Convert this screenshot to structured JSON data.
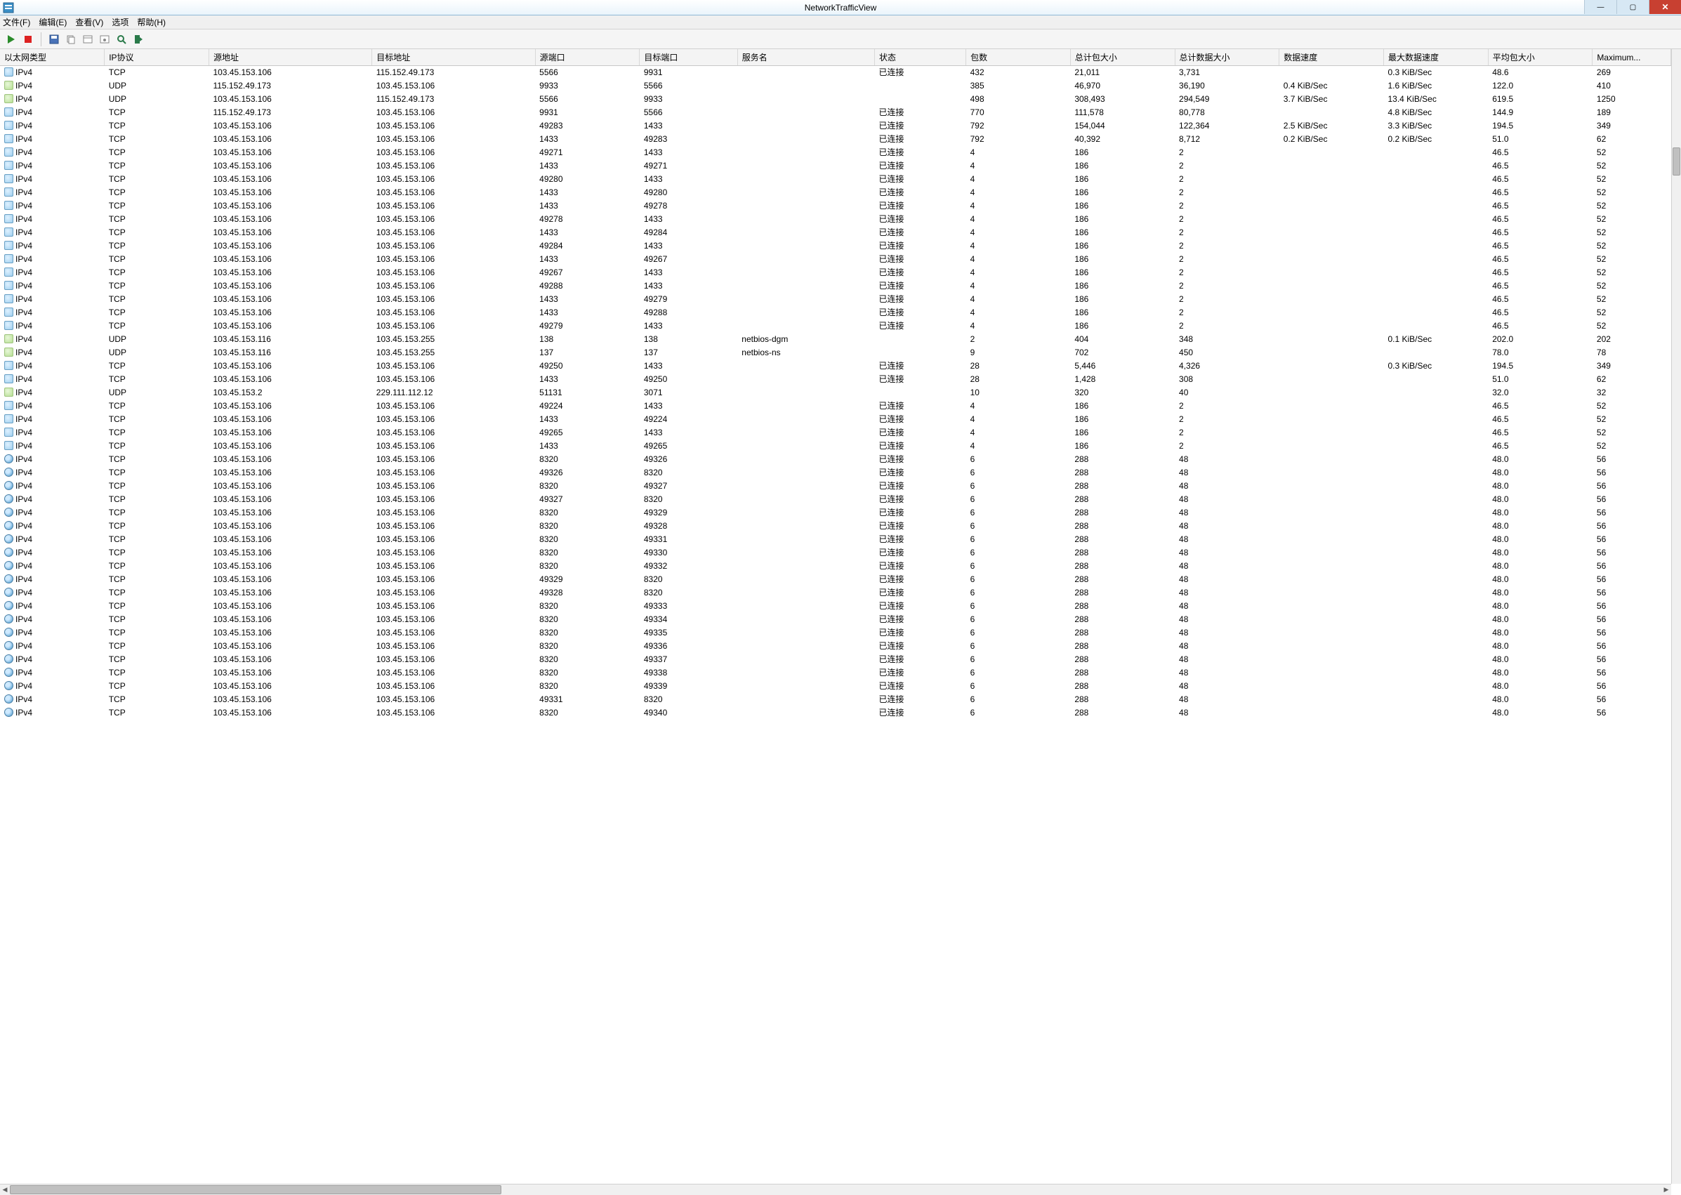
{
  "window": {
    "title": "NetworkTrafficView",
    "buttons": {
      "min": "—",
      "max": "▢",
      "close": "✕"
    }
  },
  "menu": {
    "items": [
      "文件(F)",
      "编辑(E)",
      "查看(V)",
      "选项",
      "帮助(H)"
    ]
  },
  "columns": [
    {
      "key": "eth",
      "label": "以太网类型",
      "w": 80
    },
    {
      "key": "proto",
      "label": "IP协议",
      "w": 80
    },
    {
      "key": "src",
      "label": "源地址",
      "w": 125
    },
    {
      "key": "dst",
      "label": "目标地址",
      "w": 125
    },
    {
      "key": "sport",
      "label": "源端口",
      "w": 80
    },
    {
      "key": "dport",
      "label": "目标端口",
      "w": 75
    },
    {
      "key": "svc",
      "label": "服务名",
      "w": 105
    },
    {
      "key": "status",
      "label": "状态",
      "w": 70
    },
    {
      "key": "pkts",
      "label": "包数",
      "w": 80
    },
    {
      "key": "tpsz",
      "label": "总计包大小",
      "w": 80
    },
    {
      "key": "tdsz",
      "label": "总计数据大小",
      "w": 80
    },
    {
      "key": "rate",
      "label": "数据速度",
      "w": 80
    },
    {
      "key": "maxrate",
      "label": "最大数据速度",
      "w": 80
    },
    {
      "key": "avgsz",
      "label": "平均包大小",
      "w": 80
    },
    {
      "key": "max",
      "label": "Maximum...",
      "w": 60
    }
  ],
  "rows": [
    {
      "ico": "a",
      "eth": "IPv4",
      "proto": "TCP",
      "src": "103.45.153.106",
      "dst": "115.152.49.173",
      "sport": "5566",
      "dport": "9931",
      "svc": "",
      "status": "已连接",
      "pkts": "432",
      "tpsz": "21,011",
      "tdsz": "3,731",
      "rate": "",
      "maxrate": "0.3 KiB/Sec",
      "avgsz": "48.6",
      "max": "269"
    },
    {
      "ico": "b",
      "eth": "IPv4",
      "proto": "UDP",
      "src": "115.152.49.173",
      "dst": "103.45.153.106",
      "sport": "9933",
      "dport": "5566",
      "svc": "",
      "status": "",
      "pkts": "385",
      "tpsz": "46,970",
      "tdsz": "36,190",
      "rate": "0.4 KiB/Sec",
      "maxrate": "1.6 KiB/Sec",
      "avgsz": "122.0",
      "max": "410"
    },
    {
      "ico": "b",
      "eth": "IPv4",
      "proto": "UDP",
      "src": "103.45.153.106",
      "dst": "115.152.49.173",
      "sport": "5566",
      "dport": "9933",
      "svc": "",
      "status": "",
      "pkts": "498",
      "tpsz": "308,493",
      "tdsz": "294,549",
      "rate": "3.7 KiB/Sec",
      "maxrate": "13.4 KiB/Sec",
      "avgsz": "619.5",
      "max": "1250"
    },
    {
      "ico": "a",
      "eth": "IPv4",
      "proto": "TCP",
      "src": "115.152.49.173",
      "dst": "103.45.153.106",
      "sport": "9931",
      "dport": "5566",
      "svc": "",
      "status": "已连接",
      "pkts": "770",
      "tpsz": "111,578",
      "tdsz": "80,778",
      "rate": "",
      "maxrate": "4.8 KiB/Sec",
      "avgsz": "144.9",
      "max": "189"
    },
    {
      "ico": "a",
      "eth": "IPv4",
      "proto": "TCP",
      "src": "103.45.153.106",
      "dst": "103.45.153.106",
      "sport": "49283",
      "dport": "1433",
      "svc": "",
      "status": "已连接",
      "pkts": "792",
      "tpsz": "154,044",
      "tdsz": "122,364",
      "rate": "2.5 KiB/Sec",
      "maxrate": "3.3 KiB/Sec",
      "avgsz": "194.5",
      "max": "349"
    },
    {
      "ico": "a",
      "eth": "IPv4",
      "proto": "TCP",
      "src": "103.45.153.106",
      "dst": "103.45.153.106",
      "sport": "1433",
      "dport": "49283",
      "svc": "",
      "status": "已连接",
      "pkts": "792",
      "tpsz": "40,392",
      "tdsz": "8,712",
      "rate": "0.2 KiB/Sec",
      "maxrate": "0.2 KiB/Sec",
      "avgsz": "51.0",
      "max": "62"
    },
    {
      "ico": "a",
      "eth": "IPv4",
      "proto": "TCP",
      "src": "103.45.153.106",
      "dst": "103.45.153.106",
      "sport": "49271",
      "dport": "1433",
      "svc": "",
      "status": "已连接",
      "pkts": "4",
      "tpsz": "186",
      "tdsz": "2",
      "rate": "",
      "maxrate": "",
      "avgsz": "46.5",
      "max": "52"
    },
    {
      "ico": "a",
      "eth": "IPv4",
      "proto": "TCP",
      "src": "103.45.153.106",
      "dst": "103.45.153.106",
      "sport": "1433",
      "dport": "49271",
      "svc": "",
      "status": "已连接",
      "pkts": "4",
      "tpsz": "186",
      "tdsz": "2",
      "rate": "",
      "maxrate": "",
      "avgsz": "46.5",
      "max": "52"
    },
    {
      "ico": "a",
      "eth": "IPv4",
      "proto": "TCP",
      "src": "103.45.153.106",
      "dst": "103.45.153.106",
      "sport": "49280",
      "dport": "1433",
      "svc": "",
      "status": "已连接",
      "pkts": "4",
      "tpsz": "186",
      "tdsz": "2",
      "rate": "",
      "maxrate": "",
      "avgsz": "46.5",
      "max": "52"
    },
    {
      "ico": "a",
      "eth": "IPv4",
      "proto": "TCP",
      "src": "103.45.153.106",
      "dst": "103.45.153.106",
      "sport": "1433",
      "dport": "49280",
      "svc": "",
      "status": "已连接",
      "pkts": "4",
      "tpsz": "186",
      "tdsz": "2",
      "rate": "",
      "maxrate": "",
      "avgsz": "46.5",
      "max": "52"
    },
    {
      "ico": "a",
      "eth": "IPv4",
      "proto": "TCP",
      "src": "103.45.153.106",
      "dst": "103.45.153.106",
      "sport": "1433",
      "dport": "49278",
      "svc": "",
      "status": "已连接",
      "pkts": "4",
      "tpsz": "186",
      "tdsz": "2",
      "rate": "",
      "maxrate": "",
      "avgsz": "46.5",
      "max": "52"
    },
    {
      "ico": "a",
      "eth": "IPv4",
      "proto": "TCP",
      "src": "103.45.153.106",
      "dst": "103.45.153.106",
      "sport": "49278",
      "dport": "1433",
      "svc": "",
      "status": "已连接",
      "pkts": "4",
      "tpsz": "186",
      "tdsz": "2",
      "rate": "",
      "maxrate": "",
      "avgsz": "46.5",
      "max": "52"
    },
    {
      "ico": "a",
      "eth": "IPv4",
      "proto": "TCP",
      "src": "103.45.153.106",
      "dst": "103.45.153.106",
      "sport": "1433",
      "dport": "49284",
      "svc": "",
      "status": "已连接",
      "pkts": "4",
      "tpsz": "186",
      "tdsz": "2",
      "rate": "",
      "maxrate": "",
      "avgsz": "46.5",
      "max": "52"
    },
    {
      "ico": "a",
      "eth": "IPv4",
      "proto": "TCP",
      "src": "103.45.153.106",
      "dst": "103.45.153.106",
      "sport": "49284",
      "dport": "1433",
      "svc": "",
      "status": "已连接",
      "pkts": "4",
      "tpsz": "186",
      "tdsz": "2",
      "rate": "",
      "maxrate": "",
      "avgsz": "46.5",
      "max": "52"
    },
    {
      "ico": "a",
      "eth": "IPv4",
      "proto": "TCP",
      "src": "103.45.153.106",
      "dst": "103.45.153.106",
      "sport": "1433",
      "dport": "49267",
      "svc": "",
      "status": "已连接",
      "pkts": "4",
      "tpsz": "186",
      "tdsz": "2",
      "rate": "",
      "maxrate": "",
      "avgsz": "46.5",
      "max": "52"
    },
    {
      "ico": "a",
      "eth": "IPv4",
      "proto": "TCP",
      "src": "103.45.153.106",
      "dst": "103.45.153.106",
      "sport": "49267",
      "dport": "1433",
      "svc": "",
      "status": "已连接",
      "pkts": "4",
      "tpsz": "186",
      "tdsz": "2",
      "rate": "",
      "maxrate": "",
      "avgsz": "46.5",
      "max": "52"
    },
    {
      "ico": "a",
      "eth": "IPv4",
      "proto": "TCP",
      "src": "103.45.153.106",
      "dst": "103.45.153.106",
      "sport": "49288",
      "dport": "1433",
      "svc": "",
      "status": "已连接",
      "pkts": "4",
      "tpsz": "186",
      "tdsz": "2",
      "rate": "",
      "maxrate": "",
      "avgsz": "46.5",
      "max": "52"
    },
    {
      "ico": "a",
      "eth": "IPv4",
      "proto": "TCP",
      "src": "103.45.153.106",
      "dst": "103.45.153.106",
      "sport": "1433",
      "dport": "49279",
      "svc": "",
      "status": "已连接",
      "pkts": "4",
      "tpsz": "186",
      "tdsz": "2",
      "rate": "",
      "maxrate": "",
      "avgsz": "46.5",
      "max": "52"
    },
    {
      "ico": "a",
      "eth": "IPv4",
      "proto": "TCP",
      "src": "103.45.153.106",
      "dst": "103.45.153.106",
      "sport": "1433",
      "dport": "49288",
      "svc": "",
      "status": "已连接",
      "pkts": "4",
      "tpsz": "186",
      "tdsz": "2",
      "rate": "",
      "maxrate": "",
      "avgsz": "46.5",
      "max": "52"
    },
    {
      "ico": "a",
      "eth": "IPv4",
      "proto": "TCP",
      "src": "103.45.153.106",
      "dst": "103.45.153.106",
      "sport": "49279",
      "dport": "1433",
      "svc": "",
      "status": "已连接",
      "pkts": "4",
      "tpsz": "186",
      "tdsz": "2",
      "rate": "",
      "maxrate": "",
      "avgsz": "46.5",
      "max": "52"
    },
    {
      "ico": "b",
      "eth": "IPv4",
      "proto": "UDP",
      "src": "103.45.153.116",
      "dst": "103.45.153.255",
      "sport": "138",
      "dport": "138",
      "svc": "netbios-dgm",
      "status": "",
      "pkts": "2",
      "tpsz": "404",
      "tdsz": "348",
      "rate": "",
      "maxrate": "0.1 KiB/Sec",
      "avgsz": "202.0",
      "max": "202"
    },
    {
      "ico": "b",
      "eth": "IPv4",
      "proto": "UDP",
      "src": "103.45.153.116",
      "dst": "103.45.153.255",
      "sport": "137",
      "dport": "137",
      "svc": "netbios-ns",
      "status": "",
      "pkts": "9",
      "tpsz": "702",
      "tdsz": "450",
      "rate": "",
      "maxrate": "",
      "avgsz": "78.0",
      "max": "78"
    },
    {
      "ico": "a",
      "eth": "IPv4",
      "proto": "TCP",
      "src": "103.45.153.106",
      "dst": "103.45.153.106",
      "sport": "49250",
      "dport": "1433",
      "svc": "",
      "status": "已连接",
      "pkts": "28",
      "tpsz": "5,446",
      "tdsz": "4,326",
      "rate": "",
      "maxrate": "0.3 KiB/Sec",
      "avgsz": "194.5",
      "max": "349"
    },
    {
      "ico": "a",
      "eth": "IPv4",
      "proto": "TCP",
      "src": "103.45.153.106",
      "dst": "103.45.153.106",
      "sport": "1433",
      "dport": "49250",
      "svc": "",
      "status": "已连接",
      "pkts": "28",
      "tpsz": "1,428",
      "tdsz": "308",
      "rate": "",
      "maxrate": "",
      "avgsz": "51.0",
      "max": "62"
    },
    {
      "ico": "b",
      "eth": "IPv4",
      "proto": "UDP",
      "src": "103.45.153.2",
      "dst": "229.111.112.12",
      "sport": "51131",
      "dport": "3071",
      "svc": "",
      "status": "",
      "pkts": "10",
      "tpsz": "320",
      "tdsz": "40",
      "rate": "",
      "maxrate": "",
      "avgsz": "32.0",
      "max": "32"
    },
    {
      "ico": "a",
      "eth": "IPv4",
      "proto": "TCP",
      "src": "103.45.153.106",
      "dst": "103.45.153.106",
      "sport": "49224",
      "dport": "1433",
      "svc": "",
      "status": "已连接",
      "pkts": "4",
      "tpsz": "186",
      "tdsz": "2",
      "rate": "",
      "maxrate": "",
      "avgsz": "46.5",
      "max": "52"
    },
    {
      "ico": "a",
      "eth": "IPv4",
      "proto": "TCP",
      "src": "103.45.153.106",
      "dst": "103.45.153.106",
      "sport": "1433",
      "dport": "49224",
      "svc": "",
      "status": "已连接",
      "pkts": "4",
      "tpsz": "186",
      "tdsz": "2",
      "rate": "",
      "maxrate": "",
      "avgsz": "46.5",
      "max": "52"
    },
    {
      "ico": "a",
      "eth": "IPv4",
      "proto": "TCP",
      "src": "103.45.153.106",
      "dst": "103.45.153.106",
      "sport": "49265",
      "dport": "1433",
      "svc": "",
      "status": "已连接",
      "pkts": "4",
      "tpsz": "186",
      "tdsz": "2",
      "rate": "",
      "maxrate": "",
      "avgsz": "46.5",
      "max": "52"
    },
    {
      "ico": "a",
      "eth": "IPv4",
      "proto": "TCP",
      "src": "103.45.153.106",
      "dst": "103.45.153.106",
      "sport": "1433",
      "dport": "49265",
      "svc": "",
      "status": "已连接",
      "pkts": "4",
      "tpsz": "186",
      "tdsz": "2",
      "rate": "",
      "maxrate": "",
      "avgsz": "46.5",
      "max": "52"
    },
    {
      "ico": "g",
      "eth": "IPv4",
      "proto": "TCP",
      "src": "103.45.153.106",
      "dst": "103.45.153.106",
      "sport": "8320",
      "dport": "49326",
      "svc": "",
      "status": "已连接",
      "pkts": "6",
      "tpsz": "288",
      "tdsz": "48",
      "rate": "",
      "maxrate": "",
      "avgsz": "48.0",
      "max": "56"
    },
    {
      "ico": "g",
      "eth": "IPv4",
      "proto": "TCP",
      "src": "103.45.153.106",
      "dst": "103.45.153.106",
      "sport": "49326",
      "dport": "8320",
      "svc": "",
      "status": "已连接",
      "pkts": "6",
      "tpsz": "288",
      "tdsz": "48",
      "rate": "",
      "maxrate": "",
      "avgsz": "48.0",
      "max": "56"
    },
    {
      "ico": "g",
      "eth": "IPv4",
      "proto": "TCP",
      "src": "103.45.153.106",
      "dst": "103.45.153.106",
      "sport": "8320",
      "dport": "49327",
      "svc": "",
      "status": "已连接",
      "pkts": "6",
      "tpsz": "288",
      "tdsz": "48",
      "rate": "",
      "maxrate": "",
      "avgsz": "48.0",
      "max": "56"
    },
    {
      "ico": "g",
      "eth": "IPv4",
      "proto": "TCP",
      "src": "103.45.153.106",
      "dst": "103.45.153.106",
      "sport": "49327",
      "dport": "8320",
      "svc": "",
      "status": "已连接",
      "pkts": "6",
      "tpsz": "288",
      "tdsz": "48",
      "rate": "",
      "maxrate": "",
      "avgsz": "48.0",
      "max": "56"
    },
    {
      "ico": "g",
      "eth": "IPv4",
      "proto": "TCP",
      "src": "103.45.153.106",
      "dst": "103.45.153.106",
      "sport": "8320",
      "dport": "49329",
      "svc": "",
      "status": "已连接",
      "pkts": "6",
      "tpsz": "288",
      "tdsz": "48",
      "rate": "",
      "maxrate": "",
      "avgsz": "48.0",
      "max": "56"
    },
    {
      "ico": "g",
      "eth": "IPv4",
      "proto": "TCP",
      "src": "103.45.153.106",
      "dst": "103.45.153.106",
      "sport": "8320",
      "dport": "49328",
      "svc": "",
      "status": "已连接",
      "pkts": "6",
      "tpsz": "288",
      "tdsz": "48",
      "rate": "",
      "maxrate": "",
      "avgsz": "48.0",
      "max": "56"
    },
    {
      "ico": "g",
      "eth": "IPv4",
      "proto": "TCP",
      "src": "103.45.153.106",
      "dst": "103.45.153.106",
      "sport": "8320",
      "dport": "49331",
      "svc": "",
      "status": "已连接",
      "pkts": "6",
      "tpsz": "288",
      "tdsz": "48",
      "rate": "",
      "maxrate": "",
      "avgsz": "48.0",
      "max": "56"
    },
    {
      "ico": "g",
      "eth": "IPv4",
      "proto": "TCP",
      "src": "103.45.153.106",
      "dst": "103.45.153.106",
      "sport": "8320",
      "dport": "49330",
      "svc": "",
      "status": "已连接",
      "pkts": "6",
      "tpsz": "288",
      "tdsz": "48",
      "rate": "",
      "maxrate": "",
      "avgsz": "48.0",
      "max": "56"
    },
    {
      "ico": "g",
      "eth": "IPv4",
      "proto": "TCP",
      "src": "103.45.153.106",
      "dst": "103.45.153.106",
      "sport": "8320",
      "dport": "49332",
      "svc": "",
      "status": "已连接",
      "pkts": "6",
      "tpsz": "288",
      "tdsz": "48",
      "rate": "",
      "maxrate": "",
      "avgsz": "48.0",
      "max": "56"
    },
    {
      "ico": "g",
      "eth": "IPv4",
      "proto": "TCP",
      "src": "103.45.153.106",
      "dst": "103.45.153.106",
      "sport": "49329",
      "dport": "8320",
      "svc": "",
      "status": "已连接",
      "pkts": "6",
      "tpsz": "288",
      "tdsz": "48",
      "rate": "",
      "maxrate": "",
      "avgsz": "48.0",
      "max": "56"
    },
    {
      "ico": "g",
      "eth": "IPv4",
      "proto": "TCP",
      "src": "103.45.153.106",
      "dst": "103.45.153.106",
      "sport": "49328",
      "dport": "8320",
      "svc": "",
      "status": "已连接",
      "pkts": "6",
      "tpsz": "288",
      "tdsz": "48",
      "rate": "",
      "maxrate": "",
      "avgsz": "48.0",
      "max": "56"
    },
    {
      "ico": "g",
      "eth": "IPv4",
      "proto": "TCP",
      "src": "103.45.153.106",
      "dst": "103.45.153.106",
      "sport": "8320",
      "dport": "49333",
      "svc": "",
      "status": "已连接",
      "pkts": "6",
      "tpsz": "288",
      "tdsz": "48",
      "rate": "",
      "maxrate": "",
      "avgsz": "48.0",
      "max": "56"
    },
    {
      "ico": "g",
      "eth": "IPv4",
      "proto": "TCP",
      "src": "103.45.153.106",
      "dst": "103.45.153.106",
      "sport": "8320",
      "dport": "49334",
      "svc": "",
      "status": "已连接",
      "pkts": "6",
      "tpsz": "288",
      "tdsz": "48",
      "rate": "",
      "maxrate": "",
      "avgsz": "48.0",
      "max": "56"
    },
    {
      "ico": "g",
      "eth": "IPv4",
      "proto": "TCP",
      "src": "103.45.153.106",
      "dst": "103.45.153.106",
      "sport": "8320",
      "dport": "49335",
      "svc": "",
      "status": "已连接",
      "pkts": "6",
      "tpsz": "288",
      "tdsz": "48",
      "rate": "",
      "maxrate": "",
      "avgsz": "48.0",
      "max": "56"
    },
    {
      "ico": "g",
      "eth": "IPv4",
      "proto": "TCP",
      "src": "103.45.153.106",
      "dst": "103.45.153.106",
      "sport": "8320",
      "dport": "49336",
      "svc": "",
      "status": "已连接",
      "pkts": "6",
      "tpsz": "288",
      "tdsz": "48",
      "rate": "",
      "maxrate": "",
      "avgsz": "48.0",
      "max": "56"
    },
    {
      "ico": "g",
      "eth": "IPv4",
      "proto": "TCP",
      "src": "103.45.153.106",
      "dst": "103.45.153.106",
      "sport": "8320",
      "dport": "49337",
      "svc": "",
      "status": "已连接",
      "pkts": "6",
      "tpsz": "288",
      "tdsz": "48",
      "rate": "",
      "maxrate": "",
      "avgsz": "48.0",
      "max": "56"
    },
    {
      "ico": "g",
      "eth": "IPv4",
      "proto": "TCP",
      "src": "103.45.153.106",
      "dst": "103.45.153.106",
      "sport": "8320",
      "dport": "49338",
      "svc": "",
      "status": "已连接",
      "pkts": "6",
      "tpsz": "288",
      "tdsz": "48",
      "rate": "",
      "maxrate": "",
      "avgsz": "48.0",
      "max": "56"
    },
    {
      "ico": "g",
      "eth": "IPv4",
      "proto": "TCP",
      "src": "103.45.153.106",
      "dst": "103.45.153.106",
      "sport": "8320",
      "dport": "49339",
      "svc": "",
      "status": "已连接",
      "pkts": "6",
      "tpsz": "288",
      "tdsz": "48",
      "rate": "",
      "maxrate": "",
      "avgsz": "48.0",
      "max": "56"
    },
    {
      "ico": "g",
      "eth": "IPv4",
      "proto": "TCP",
      "src": "103.45.153.106",
      "dst": "103.45.153.106",
      "sport": "49331",
      "dport": "8320",
      "svc": "",
      "status": "已连接",
      "pkts": "6",
      "tpsz": "288",
      "tdsz": "48",
      "rate": "",
      "maxrate": "",
      "avgsz": "48.0",
      "max": "56"
    },
    {
      "ico": "g",
      "eth": "IPv4",
      "proto": "TCP",
      "src": "103.45.153.106",
      "dst": "103.45.153.106",
      "sport": "8320",
      "dport": "49340",
      "svc": "",
      "status": "已连接",
      "pkts": "6",
      "tpsz": "288",
      "tdsz": "48",
      "rate": "",
      "maxrate": "",
      "avgsz": "48.0",
      "max": "56"
    }
  ]
}
